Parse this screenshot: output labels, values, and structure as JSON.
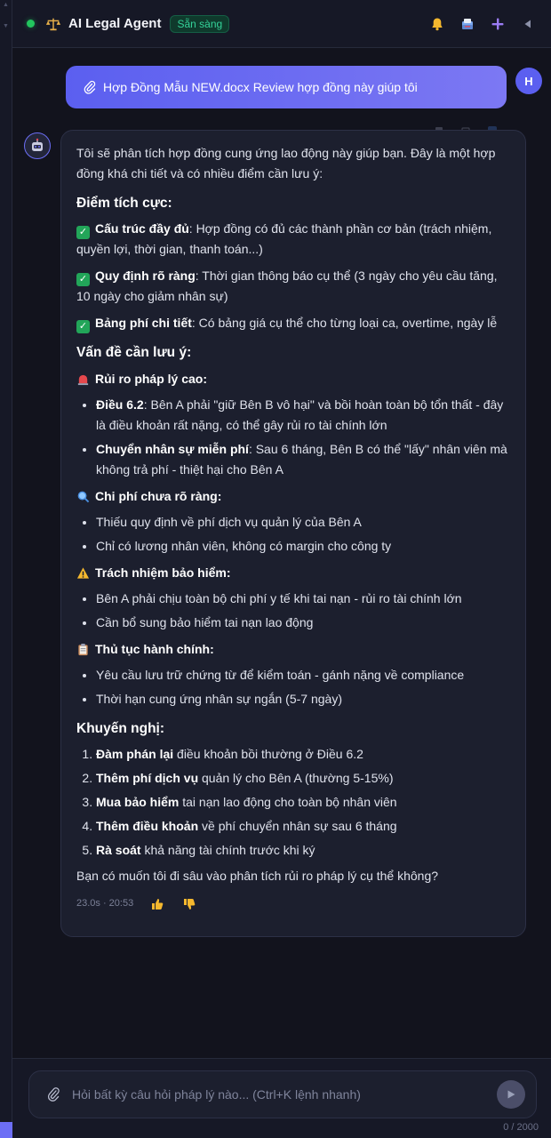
{
  "header": {
    "title": "AI Legal Agent",
    "status_badge": "Sẵn sàng",
    "icons": [
      "bell-icon",
      "inbox-icon",
      "plus-icon",
      "collapse-icon"
    ],
    "colors": {
      "status": "#22c55e",
      "accent": "#6c6ef5"
    }
  },
  "user_message": {
    "text": "Hợp Đồng Mẫu NEW.docx Review hợp đồng này giúp tôi",
    "avatar_initial": "H"
  },
  "assistant_message": {
    "intro": "Tôi sẽ phân tích hợp đồng cung ứng lao động này giúp bạn. Đây là một hợp đồng khá chi tiết và có nhiều điểm cần lưu ý:",
    "positives_heading": "Điểm tích cực:",
    "positives": [
      {
        "bold": "Cấu trúc đầy đủ",
        "text": ": Hợp đồng có đủ các thành phần cơ bản (trách nhiệm, quyền lợi, thời gian, thanh toán...)"
      },
      {
        "bold": "Quy định rõ ràng",
        "text": ": Thời gian thông báo cụ thể (3 ngày cho yêu cầu tăng, 10 ngày cho giảm nhân sự)"
      },
      {
        "bold": "Bảng phí chi tiết",
        "text": ": Có bảng giá cụ thể cho từng loại ca, overtime, ngày lễ"
      }
    ],
    "issues_heading": "Vấn đề cần lưu ý:",
    "issue_groups": [
      {
        "title": "Rủi ro pháp lý cao:",
        "items": [
          {
            "bold": "Điều 6.2",
            "text": ": Bên A phải \"giữ Bên B vô hại\" và bồi hoàn toàn bộ tổn thất - đây là điều khoản rất nặng, có thể gây rủi ro tài chính lớn"
          },
          {
            "bold": "Chuyển nhân sự miễn phí",
            "text": ": Sau 6 tháng, Bên B có thể \"lấy\" nhân viên mà không trả phí - thiệt hại cho Bên A"
          }
        ]
      },
      {
        "title": "Chi phí chưa rõ ràng:",
        "items": [
          {
            "bold": "",
            "text": "Thiếu quy định về phí dịch vụ quản lý của Bên A"
          },
          {
            "bold": "",
            "text": "Chỉ có lương nhân viên, không có margin cho công ty"
          }
        ]
      },
      {
        "title": "Trách nhiệm bảo hiểm:",
        "items": [
          {
            "bold": "",
            "text": "Bên A phải chịu toàn bộ chi phí y tế khi tai nạn - rủi ro tài chính lớn"
          },
          {
            "bold": "",
            "text": "Cần bổ sung bảo hiểm tai nạn lao động"
          }
        ]
      },
      {
        "title": "Thủ tục hành chính:",
        "items": [
          {
            "bold": "",
            "text": "Yêu cầu lưu trữ chứng từ để kiểm toán - gánh nặng về compliance"
          },
          {
            "bold": "",
            "text": "Thời hạn cung ứng nhân sự ngắn (5-7 ngày)"
          }
        ]
      }
    ],
    "recommend_heading": "Khuyến nghị:",
    "recommendations": [
      {
        "bold": "Đàm phán lại",
        "text": " điều khoản bồi thường ở Điều 6.2"
      },
      {
        "bold": "Thêm phí dịch vụ",
        "text": " quản lý cho Bên A (thường 5-15%)"
      },
      {
        "bold": "Mua bảo hiểm",
        "text": " tai nạn lao động cho toàn bộ nhân viên"
      },
      {
        "bold": "Thêm điều khoản",
        "text": " về phí chuyển nhân sự sau 6 tháng"
      },
      {
        "bold": "Rà soát",
        "text": " khả năng tài chính trước khi ký"
      }
    ],
    "closing": "Bạn có muốn tôi đi sâu vào phân tích rủi ro pháp lý cụ thể không?",
    "meta": "23.0s · 20:53"
  },
  "composer": {
    "placeholder": "Hỏi bất kỳ câu hỏi pháp lý nào... (Ctrl+K lệnh nhanh)",
    "value": "",
    "char_count": "0 / 2000"
  }
}
